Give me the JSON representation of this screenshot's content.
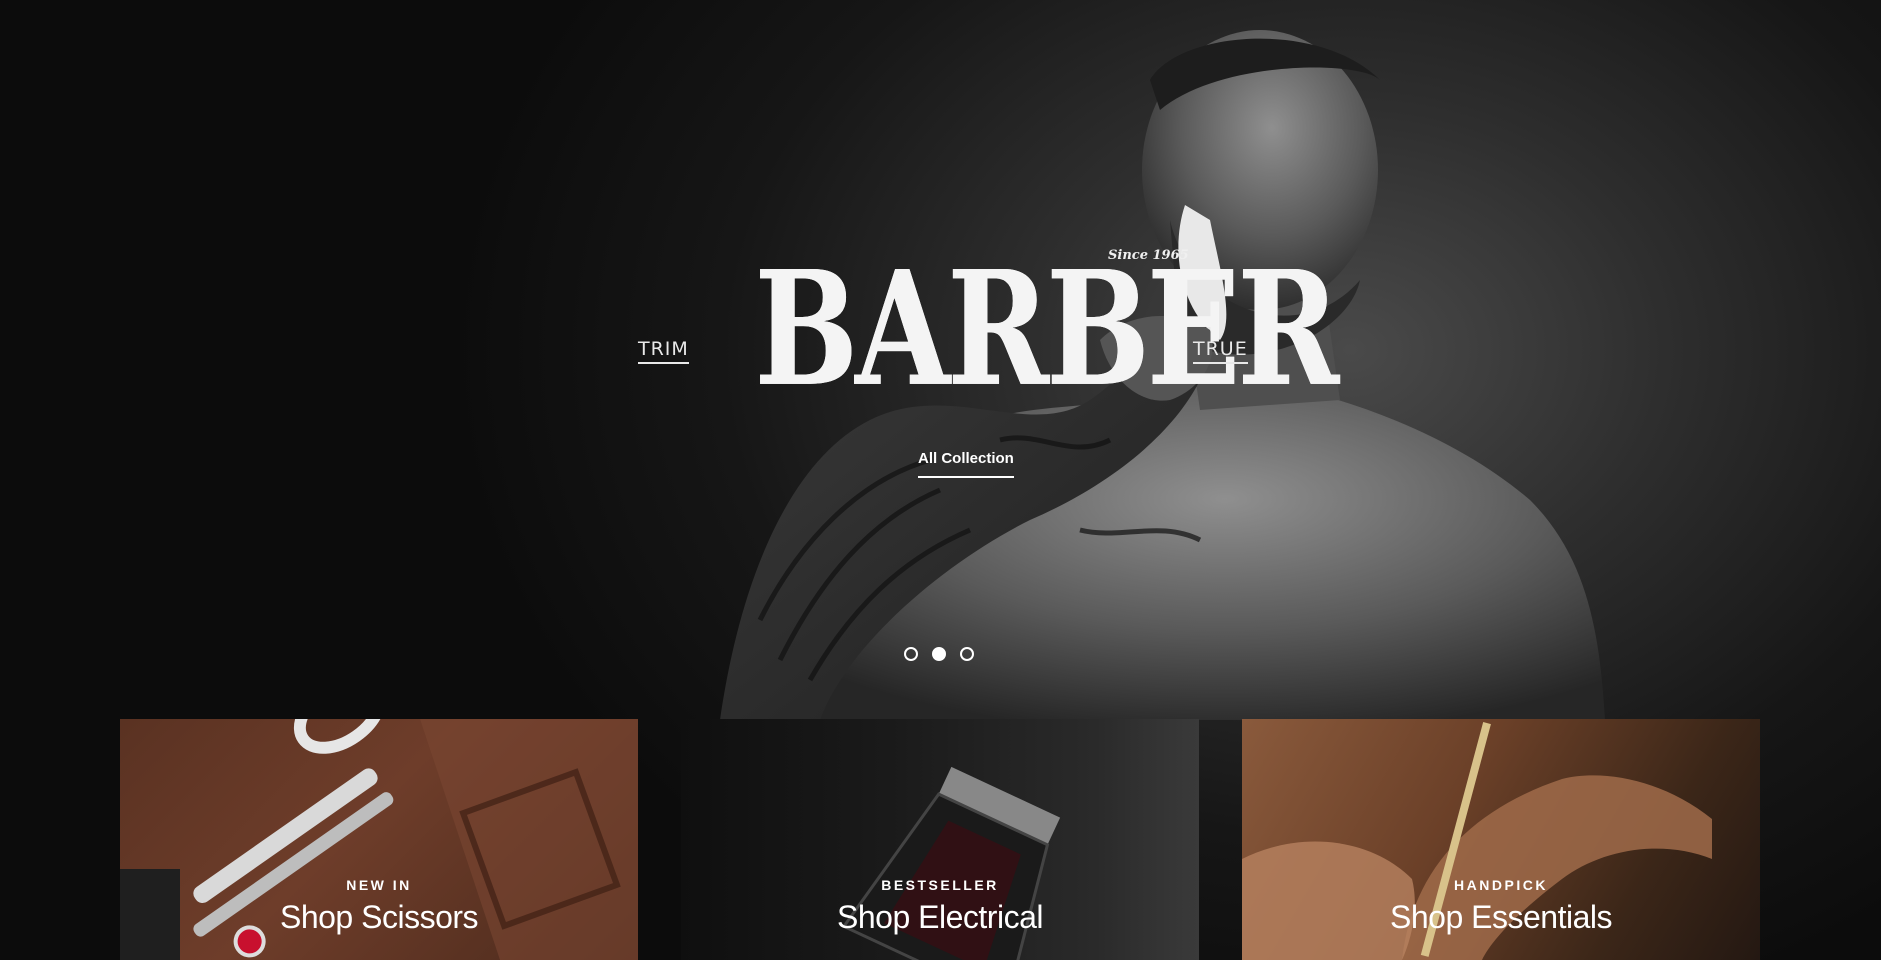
{
  "hero": {
    "left_word": "TRIM",
    "right_word": "TRUE",
    "logo_text": "BARBER",
    "logo_since": "Since 1965",
    "cta_label": "All Collection",
    "slides": [
      {
        "active": false
      },
      {
        "active": true
      },
      {
        "active": false
      }
    ]
  },
  "cards": [
    {
      "tag": "NEW IN",
      "title": "Shop Scissors"
    },
    {
      "tag": "BESTSELLER",
      "title": "Shop Electrical"
    },
    {
      "tag": "HANDPICK",
      "title": "Shop Essentials"
    }
  ],
  "colors": {
    "background": "#141414",
    "text": "#ffffff"
  }
}
